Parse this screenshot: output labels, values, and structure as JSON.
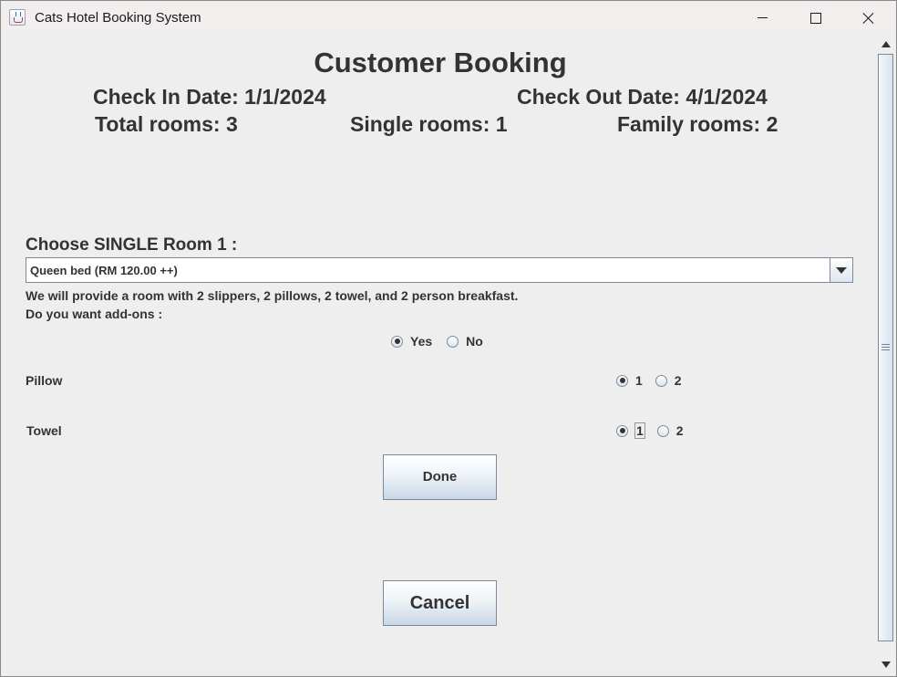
{
  "window": {
    "title": "Cats Hotel Booking System",
    "app_icon": "java-cup-icon"
  },
  "header": {
    "title": "Customer Booking",
    "check_in": "Check In Date: 1/1/2024",
    "check_out": "Check Out Date: 4/1/2024",
    "total_rooms": "Total rooms: 3",
    "single_rooms": "Single rooms: 1",
    "family_rooms": "Family rooms: 2"
  },
  "room": {
    "choose_label": "Choose SINGLE Room 1 :",
    "selected_option": "Queen bed (RM 120.00 ++)",
    "description": "We will provide a room with 2 slippers, 2 pillows, 2 towel, and 2 person breakfast.",
    "addons_question": "Do you want add-ons :"
  },
  "addons": {
    "yes_label": "Yes",
    "no_label": "No",
    "selected": "Yes"
  },
  "pillow": {
    "label": "Pillow",
    "options": [
      "1",
      "2"
    ],
    "selected": "1"
  },
  "towel": {
    "label": "Towel",
    "options": [
      "1",
      "2"
    ],
    "selected": "1"
  },
  "buttons": {
    "done": "Done",
    "cancel": "Cancel"
  },
  "colors": {
    "text": "#333333",
    "background": "#eeeeee",
    "titlebar": "#f3eeee",
    "button_gradient_end": "#c9d7e6"
  }
}
